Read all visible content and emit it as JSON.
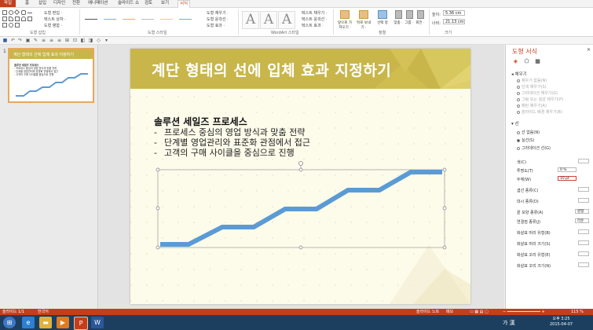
{
  "menu": {
    "tabs": [
      "파일",
      "홈",
      "삽입",
      "디자인",
      "전환",
      "애니메이션",
      "슬라이드 쇼",
      "검토",
      "보기",
      "서식"
    ],
    "active": "서식"
  },
  "ribbon": {
    "shape_edit": [
      "도형 편집 ·",
      "텍스트 상자 ·",
      "도형 병합 ·"
    ],
    "group_insert": "도형 삽입",
    "style_opts": [
      "도형 채우기 ·",
      "도형 윤곽선 ·",
      "도형 효과 ·"
    ],
    "group_style": "도형 스타일",
    "wordart_opts": [
      "텍스트 채우기 ·",
      "텍스트 윤곽선 ·",
      "텍스트 효과 ·"
    ],
    "group_wordart": "WordArt 스타일",
    "arrange": [
      "앞으로 가져오기 ·",
      "뒤로 보내기 ·",
      "선택 창",
      "맞춤 ·",
      "그룹 ·",
      "회전 ·"
    ],
    "group_arrange": "정렬",
    "height_label": "높이:",
    "height_value": "5.36 cm",
    "width_label": "너비:",
    "width_value": "21.13 cm",
    "group_size": "크기"
  },
  "thumbnail": {
    "number": "1",
    "title": "계단 형태의 선에 입체 효과 지정하기",
    "lines": [
      "솔루션 세일즈 프로세스",
      "- 프로세스 중심의 영업 방식과 맞춤 전략",
      "- 단계별 영업관리와 표준화 관점에서 접근",
      "- 고객의 구매 사이클을 중심으로 진행"
    ]
  },
  "slide": {
    "title": "계단 형태의 선에 입체 효과 지정하기",
    "heading": "솔루션 세일즈 프로세스",
    "bullets": [
      "프로세스 중심의 영업 방식과 맞춤 전략",
      "단계별 영업관리와 표준화 관점에서 접근",
      "고객의 구매 사이클을 중심으로 진행"
    ],
    "line_color": "#5b9bd5"
  },
  "format_pane": {
    "title": "도형 서식",
    "fill_section": "채우기",
    "fill_options": [
      "채우기 없음(N)",
      "단색 채우기(S)",
      "그라데이션 채우기(G)",
      "그림 또는 질감 채우기(P)",
      "패턴 채우기(A)",
      "슬라이드 배경 채우기(B)"
    ],
    "line_section": "선",
    "line_options": [
      "선 없음(N)",
      "실선(S)",
      "그라데이션 선(G)"
    ],
    "props": [
      "색(C)",
      "투명도(T)",
      "두께(W)",
      "겹선 종류(C)",
      "대시 종류(D)",
      "끝 모양 종류(A)",
      "연결점 종류(J)",
      "화살표 머리 유형(B)",
      "화살표 머리 크기(S)",
      "화살표 꼬리 유형(E)",
      "화살표 꼬리 크기(N)"
    ],
    "transparency": "0 %",
    "width": "10 pt",
    "cap_type": "원형",
    "join_type": "라운"
  },
  "statusbar": {
    "slide_info": "슬라이드 1/1",
    "language": "한국어",
    "notes": "슬라이드 노트",
    "comments": "메모",
    "zoom": "115 %"
  },
  "taskbar": {
    "time": "오후 3:25",
    "date": "2015-04-07",
    "ime": "가 漢"
  },
  "colors": {
    "accent": "#c43e1c",
    "title_bar": "#c9b64a",
    "slide_bg": "#fdfbea"
  }
}
